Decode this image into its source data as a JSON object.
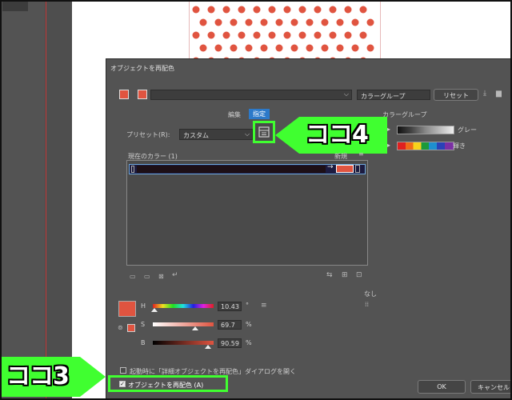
{
  "background": {
    "left_tab": ""
  },
  "dialog": {
    "title": "オブジェクトを再配色",
    "color_group_field": "カラーグループ",
    "reset_label": "リセット",
    "tabs": [
      {
        "label": "編集"
      },
      {
        "label": "指定"
      }
    ],
    "preset_label": "プリセット(R):",
    "preset_value": "カスタム",
    "current_colors_label": "現在のカラー (1)",
    "new_label": "新規",
    "color_groups_heading": "カラーグループ",
    "color_groups": [
      {
        "label": "グレー"
      },
      {
        "label": "輝き"
      }
    ],
    "sliders": [
      {
        "label": "H",
        "value": "10.43",
        "unit": "°",
        "level": 0.03
      },
      {
        "label": "S",
        "value": "69.7",
        "unit": "%",
        "level": 0.697
      },
      {
        "label": "B",
        "value": "90.59",
        "unit": "%",
        "level": 0.906
      }
    ],
    "none_label": "なし",
    "open_on_launch_label": "起動時に「詳細オブジェクトを再配色」ダイアログを開く",
    "recolor_label": "オブジェクトを再配色 (A)",
    "ok_label": "OK",
    "cancel_label": "キャンセル"
  },
  "annotations": {
    "koko4": "ココ4",
    "koko3": "ココ3"
  },
  "colors": {
    "accent_red": "#e05440",
    "highlight_green": "#40ff30",
    "selected_tab": "#2c79c9"
  }
}
